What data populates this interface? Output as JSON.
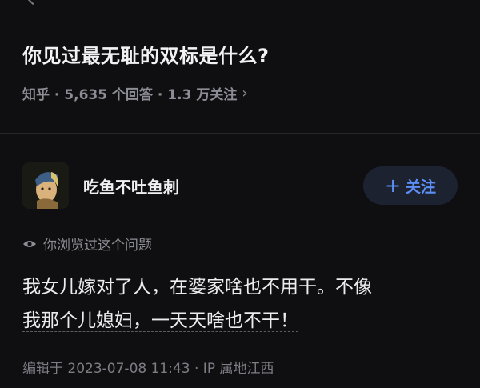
{
  "question": {
    "title": "你见过最无耻的双标是什么?",
    "meta": "知乎 · 5,635 个回答 · 1.3 万关注",
    "meta_chevron": "›"
  },
  "author": {
    "name": "吃鱼不吐鱼刺",
    "follow_plus": "+",
    "follow_label": "关注"
  },
  "viewed": {
    "icon": "eye-icon",
    "text": "你浏览过这个问题"
  },
  "answer": {
    "line1": "我女儿嫁对了人，在婆家啥也不用干。不像",
    "line2": "我那个儿媳妇，一天天啥也不干！"
  },
  "edit_info": "编辑于 2023-07-08 11:43 · IP 属地江西",
  "colors": {
    "background": "#0f0f11",
    "accent": "#5d8ef5",
    "follow_bg": "#1c2230",
    "muted": "#8d8d95"
  }
}
